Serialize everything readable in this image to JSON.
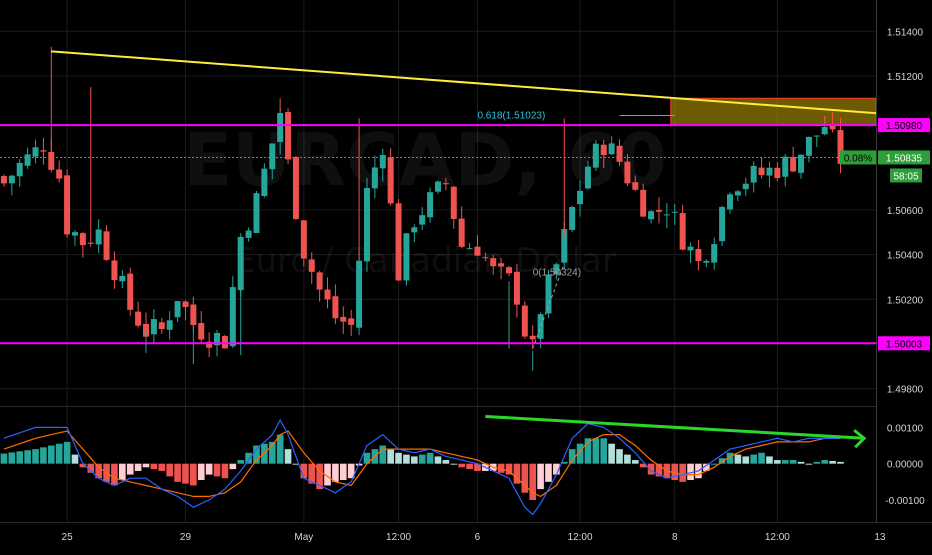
{
  "watermark": {
    "symbol": "EURCAD, 60",
    "name": "Euro / Canadian Dollar"
  },
  "colors": {
    "background": "#000000",
    "up": "#26a69a",
    "down": "#ef5350",
    "grid": "#1b1b1b",
    "level_line": "#ff00ff",
    "trendline": "#ffeb3b",
    "supply_zone": "#c8a400",
    "supply_zone_border": "#ff3b30",
    "price_line": "#26a69a",
    "price_tag": "#2e9e3a",
    "macd_line": "#2962ff",
    "signal_line": "#ff6d00",
    "hist_up_strong": "#26a69a",
    "hist_up_weak": "#b2dfdb",
    "hist_down_strong": "#ef5350",
    "hist_down_weak": "#ffcdd2",
    "divergence_arrow": "#2bd62b",
    "fib_label": "#26c6da",
    "axis_text": "#d1d4dc"
  },
  "price_axis": {
    "ticks": [
      "1.51400",
      "1.51200",
      "1.50980",
      "1.50600",
      "1.50400",
      "1.50200",
      "1.49800"
    ],
    "tick_values": [
      1.514,
      1.512,
      1.5098,
      1.506,
      1.504,
      1.502,
      1.498
    ],
    "range": [
      1.4974,
      1.5154
    ]
  },
  "macd_axis": {
    "ticks": [
      "0.00100",
      "0.00000",
      "-0.00100"
    ],
    "tick_values": [
      0.001,
      0.0,
      -0.001
    ],
    "range": [
      -0.00155,
      0.00145
    ]
  },
  "time_axis": {
    "labels": [
      "25",
      "29",
      "May",
      "12:00",
      "6",
      "12:00",
      "8",
      "12:00",
      "13"
    ],
    "bar_index": [
      8,
      23,
      38,
      50,
      60,
      73,
      85,
      98,
      111
    ]
  },
  "levels": {
    "resistance": {
      "value": 1.5098,
      "label": "1.50980"
    },
    "support": {
      "value": 1.50003,
      "label": "1.50003"
    }
  },
  "price_tag": {
    "current": 1.50835,
    "label": "1.50835",
    "change": "0.08%",
    "countdown": "58:05"
  },
  "fib": {
    "level_618": "0.618(1.51023)",
    "level_0": "0(1.50324)",
    "value_618": 1.51023,
    "value_0": 1.50324
  },
  "chart_data": {
    "type": "candlestick",
    "symbol": "EURCAD",
    "timeframe": "60",
    "description": "Euro / Canadian Dollar",
    "bars": 111,
    "price_range": [
      1.4974,
      1.5154
    ],
    "close_path": [
      [
        0,
        1.5072
      ],
      [
        2,
        1.508
      ],
      [
        4,
        1.5086
      ],
      [
        5,
        1.509
      ],
      [
        7,
        1.5075
      ],
      [
        8,
        1.5053
      ],
      [
        10,
        1.5046
      ],
      [
        12,
        1.505
      ],
      [
        14,
        1.5034
      ],
      [
        16,
        1.5016
      ],
      [
        18,
        1.5006
      ],
      [
        20,
        1.5006
      ],
      [
        22,
        1.5022
      ],
      [
        24,
        1.5009
      ],
      [
        26,
        1.5004
      ],
      [
        28,
        1.5002
      ],
      [
        30,
        1.5048
      ],
      [
        32,
        1.5064
      ],
      [
        34,
        1.509
      ],
      [
        35,
        1.5104
      ],
      [
        36,
        1.508
      ],
      [
        38,
        1.5042
      ],
      [
        40,
        1.5024
      ],
      [
        42,
        1.5012
      ],
      [
        44,
        1.5008
      ],
      [
        46,
        1.5068
      ],
      [
        48,
        1.509
      ],
      [
        50,
        1.5032
      ],
      [
        52,
        1.5056
      ],
      [
        54,
        1.5064
      ],
      [
        56,
        1.5072
      ],
      [
        58,
        1.5044
      ],
      [
        60,
        1.5044
      ],
      [
        62,
        1.5032
      ],
      [
        64,
        1.5028
      ],
      [
        65,
        1.5022
      ],
      [
        66,
        1.5006
      ],
      [
        67,
        1.4997
      ],
      [
        68,
        1.5016
      ],
      [
        70,
        1.5035
      ],
      [
        72,
        1.506
      ],
      [
        74,
        1.508
      ],
      [
        76,
        1.509
      ],
      [
        78,
        1.5082
      ],
      [
        80,
        1.5068
      ],
      [
        82,
        1.5058
      ],
      [
        84,
        1.5062
      ],
      [
        86,
        1.5048
      ],
      [
        88,
        1.5036
      ],
      [
        90,
        1.505
      ],
      [
        92,
        1.5072
      ],
      [
        94,
        1.5074
      ],
      [
        96,
        1.5076
      ],
      [
        98,
        1.5079
      ],
      [
        100,
        1.5082
      ],
      [
        102,
        1.509
      ],
      [
        104,
        1.5098
      ],
      [
        106,
        1.5083
      ]
    ],
    "annotations": [
      {
        "type": "horizontal_line",
        "value": 1.5098,
        "label": "1.50980"
      },
      {
        "type": "horizontal_line",
        "value": 1.50003,
        "label": "1.50003"
      },
      {
        "type": "trendline",
        "from": [
          6,
          1.5131
        ],
        "to": [
          123,
          1.51
        ]
      },
      {
        "type": "zone",
        "bars": [
          85,
          111
        ],
        "price": [
          1.5098,
          1.511
        ]
      },
      {
        "type": "fib",
        "levels": [
          "0.618(1.51023)",
          "0(1.50324)"
        ]
      }
    ],
    "macd": {
      "hist": [
        [
          0,
          0.00028
        ],
        [
          4,
          0.0004
        ],
        [
          8,
          0.0006
        ],
        [
          10,
          -0.0001
        ],
        [
          12,
          -0.0004
        ],
        [
          14,
          -0.0006
        ],
        [
          16,
          -0.0003
        ],
        [
          18,
          -0.0001
        ],
        [
          20,
          -0.0002
        ],
        [
          22,
          -0.0005
        ],
        [
          24,
          -0.0006
        ],
        [
          26,
          -0.0003
        ],
        [
          28,
          -0.0004
        ],
        [
          30,
          0.0001
        ],
        [
          32,
          0.0005
        ],
        [
          34,
          0.0006
        ],
        [
          35,
          0.0008
        ],
        [
          36,
          0.0004
        ],
        [
          38,
          -0.0004
        ],
        [
          40,
          -0.0007
        ],
        [
          42,
          -0.0005
        ],
        [
          44,
          -0.0004
        ],
        [
          46,
          0.0003
        ],
        [
          48,
          0.0005
        ],
        [
          50,
          0.0003
        ],
        [
          52,
          0.0002
        ],
        [
          54,
          0.0003
        ],
        [
          56,
          0.0001
        ],
        [
          58,
          -0.0001
        ],
        [
          60,
          -0.0002
        ],
        [
          62,
          -0.0002
        ],
        [
          64,
          -0.0003
        ],
        [
          66,
          -0.0008
        ],
        [
          67,
          -0.001
        ],
        [
          68,
          -0.0007
        ],
        [
          70,
          -0.0003
        ],
        [
          72,
          0.0004
        ],
        [
          74,
          0.0007
        ],
        [
          76,
          0.0007
        ],
        [
          78,
          0.0004
        ],
        [
          80,
          0.0001
        ],
        [
          82,
          -0.0003
        ],
        [
          84,
          -0.0004
        ],
        [
          86,
          -0.0005
        ],
        [
          88,
          -0.0004
        ],
        [
          90,
          0.0
        ],
        [
          92,
          0.0003
        ],
        [
          94,
          0.0002
        ],
        [
          96,
          0.0003
        ],
        [
          98,
          0.0001
        ],
        [
          100,
          0.0001
        ],
        [
          102,
          0.0
        ],
        [
          104,
          0.0001
        ],
        [
          106,
          5e-05
        ]
      ],
      "macd_line": [
        [
          0,
          0.0007
        ],
        [
          4,
          0.001
        ],
        [
          8,
          0.001
        ],
        [
          10,
          0.0
        ],
        [
          12,
          -0.0004
        ],
        [
          14,
          -0.0006
        ],
        [
          16,
          -0.0004
        ],
        [
          18,
          -0.0004
        ],
        [
          20,
          -0.0007
        ],
        [
          22,
          -0.0009
        ],
        [
          24,
          -0.0012
        ],
        [
          26,
          -0.001
        ],
        [
          28,
          -0.0007
        ],
        [
          30,
          -0.0002
        ],
        [
          32,
          0.0004
        ],
        [
          34,
          0.0008
        ],
        [
          35,
          0.0012
        ],
        [
          36,
          0.0008
        ],
        [
          38,
          -0.0004
        ],
        [
          40,
          -0.0006
        ],
        [
          42,
          -0.0008
        ],
        [
          44,
          -0.0005
        ],
        [
          46,
          0.0005
        ],
        [
          48,
          0.0008
        ],
        [
          50,
          0.0004
        ],
        [
          52,
          0.0003
        ],
        [
          54,
          0.0004
        ],
        [
          56,
          0.0002
        ],
        [
          58,
          0.0001
        ],
        [
          60,
          0.0
        ],
        [
          62,
          -0.0002
        ],
        [
          64,
          -0.0004
        ],
        [
          66,
          -0.0012
        ],
        [
          67,
          -0.0014
        ],
        [
          68,
          -0.0011
        ],
        [
          70,
          -0.0003
        ],
        [
          72,
          0.0007
        ],
        [
          74,
          0.0011
        ],
        [
          76,
          0.001
        ],
        [
          78,
          0.0007
        ],
        [
          80,
          0.0003
        ],
        [
          82,
          -0.0002
        ],
        [
          84,
          -0.0004
        ],
        [
          86,
          -0.0003
        ],
        [
          88,
          -0.0002
        ],
        [
          90,
          0.0001
        ],
        [
          92,
          0.0004
        ],
        [
          94,
          0.0005
        ],
        [
          96,
          0.0006
        ],
        [
          98,
          0.0007
        ],
        [
          100,
          0.0006
        ],
        [
          102,
          0.0007
        ],
        [
          104,
          0.0007
        ],
        [
          106,
          0.0007
        ]
      ],
      "signal_line": [
        [
          0,
          0.0004
        ],
        [
          4,
          0.0007
        ],
        [
          8,
          0.0009
        ],
        [
          10,
          0.0004
        ],
        [
          12,
          -0.0001
        ],
        [
          14,
          -0.0004
        ],
        [
          16,
          -0.0005
        ],
        [
          18,
          -0.0006
        ],
        [
          20,
          -0.0007
        ],
        [
          22,
          -0.0008
        ],
        [
          24,
          -0.0009
        ],
        [
          26,
          -0.0009
        ],
        [
          28,
          -0.0008
        ],
        [
          30,
          -0.0005
        ],
        [
          32,
          0.0001
        ],
        [
          34,
          0.0005
        ],
        [
          35,
          0.0008
        ],
        [
          36,
          0.0009
        ],
        [
          38,
          0.0003
        ],
        [
          40,
          -0.0002
        ],
        [
          42,
          -0.0005
        ],
        [
          44,
          -0.0006
        ],
        [
          46,
          0.0
        ],
        [
          48,
          0.0004
        ],
        [
          50,
          0.0004
        ],
        [
          52,
          0.0004
        ],
        [
          54,
          0.0004
        ],
        [
          56,
          0.0003
        ],
        [
          58,
          0.0002
        ],
        [
          60,
          0.0001
        ],
        [
          62,
          -0.0001
        ],
        [
          64,
          -0.0002
        ],
        [
          66,
          -0.0006
        ],
        [
          67,
          -0.0008
        ],
        [
          68,
          -0.0009
        ],
        [
          70,
          -0.0006
        ],
        [
          72,
          0.0001
        ],
        [
          74,
          0.0006
        ],
        [
          76,
          0.0008
        ],
        [
          78,
          0.0008
        ],
        [
          80,
          0.0005
        ],
        [
          82,
          0.0001
        ],
        [
          84,
          -0.0002
        ],
        [
          86,
          -0.0003
        ],
        [
          88,
          -0.0003
        ],
        [
          90,
          -0.0001
        ],
        [
          92,
          0.0002
        ],
        [
          94,
          0.0004
        ],
        [
          96,
          0.0005
        ],
        [
          98,
          0.0006
        ],
        [
          100,
          0.0006
        ],
        [
          102,
          0.0006
        ],
        [
          104,
          0.0007
        ],
        [
          106,
          0.0007
        ]
      ],
      "divergence": {
        "from": [
          61,
          0.0013
        ],
        "to": [
          109,
          0.0007
        ]
      }
    }
  }
}
